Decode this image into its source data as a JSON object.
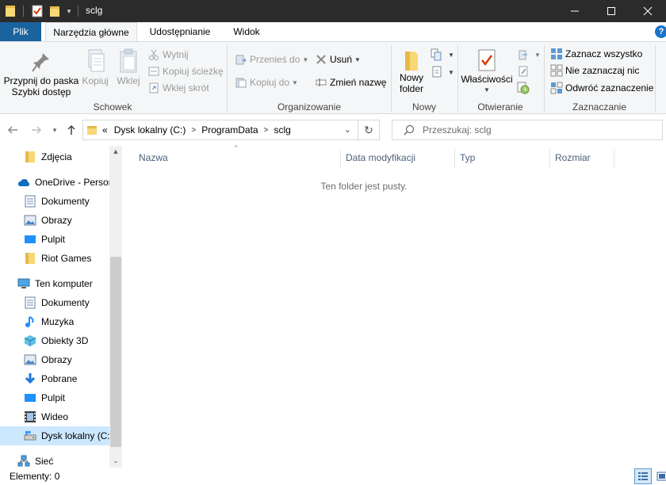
{
  "window": {
    "title": "sclg",
    "controls": [
      "minimize-icon",
      "maximize-icon",
      "close-icon"
    ]
  },
  "ribbon_tabs": [
    {
      "label": "Plik"
    },
    {
      "label": "Narzędzia główne",
      "active": true
    },
    {
      "label": "Udostępnianie"
    },
    {
      "label": "Widok"
    }
  ],
  "ribbon": {
    "schowek": {
      "label": "Schowek",
      "pin_line1": "Przypnij do paska",
      "pin_line2": "Szybki dostęp",
      "copy": "Kopiuj",
      "paste": "Wklej",
      "cut": "Wytnij",
      "copy_path": "Kopiuj ścieżkę",
      "paste_shortcut": "Wklej skrót"
    },
    "organizowanie": {
      "label": "Organizowanie",
      "move_to": "Przenieś do",
      "copy_to": "Kopiuj do",
      "delete": "Usuń",
      "rename": "Zmień nazwę"
    },
    "nowy": {
      "label": "Nowy",
      "new_folder_line1": "Nowy",
      "new_folder_line2": "folder"
    },
    "otwieranie": {
      "label": "Otwieranie",
      "properties": "Właściwości"
    },
    "zaznaczanie": {
      "label": "Zaznaczanie",
      "select_all": "Zaznacz wszystko",
      "select_none": "Nie zaznaczaj nic",
      "invert": "Odwróć zaznaczenie"
    }
  },
  "address": {
    "overflow": "«",
    "crumbs": [
      "Dysk lokalny (C:)",
      "ProgramData",
      "sclg"
    ],
    "search_placeholder": "Przeszukaj: sclg"
  },
  "nav_pane": {
    "items": [
      {
        "label": "Zdjęcia",
        "icon": "folder-icon"
      },
      {
        "label": "OneDrive - Persor",
        "icon": "onedrive-icon"
      },
      {
        "label": "Dokumenty",
        "icon": "documents-icon"
      },
      {
        "label": "Obrazy",
        "icon": "pictures-icon"
      },
      {
        "label": "Pulpit",
        "icon": "desktop-icon"
      },
      {
        "label": "Riot Games",
        "icon": "folder-icon"
      },
      {
        "label": "Ten komputer",
        "icon": "computer-icon"
      },
      {
        "label": "Dokumenty",
        "icon": "documents-icon"
      },
      {
        "label": "Muzyka",
        "icon": "music-icon"
      },
      {
        "label": "Obiekty 3D",
        "icon": "objects-3d-icon"
      },
      {
        "label": "Obrazy",
        "icon": "pictures-icon"
      },
      {
        "label": "Pobrane",
        "icon": "downloads-icon"
      },
      {
        "label": "Pulpit",
        "icon": "desktop-icon"
      },
      {
        "label": "Wideo",
        "icon": "video-icon"
      },
      {
        "label": "Dysk lokalny (C:)",
        "icon": "drive-icon",
        "selected": true
      },
      {
        "label": "Sieć",
        "icon": "network-icon"
      }
    ]
  },
  "content": {
    "columns": [
      "Nazwa",
      "Data modyfikacji",
      "Typ",
      "Rozmiar"
    ],
    "empty_message": "Ten folder jest pusty."
  },
  "status": {
    "items_text": "Elementy: 0"
  },
  "colors": {
    "accent": "#19639e",
    "selection": "#cce8ff",
    "titlebar": "#2b2b2b",
    "folder": "#f8d775"
  }
}
